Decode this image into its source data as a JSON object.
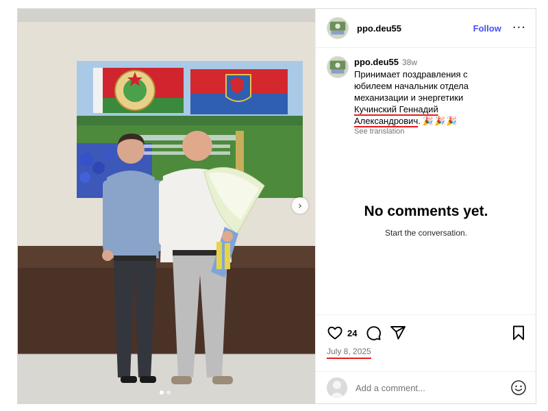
{
  "header": {
    "username": "ppo.deu55",
    "follow_label": "Follow",
    "more_label": "···"
  },
  "caption": {
    "username": "ppo.deu55",
    "time": "38w",
    "text_plain": "Принимает поздравления с юбилеем начальник отдела механизации и энергетики ",
    "text_name": "Кучинский Геннадий Александрович",
    "text_end": ".",
    "emoji": "🎉🎉🎉",
    "see_translation": "See translation"
  },
  "comments": {
    "empty_title": "No comments yet.",
    "empty_subtitle": "Start the conversation."
  },
  "actions": {
    "like_count": "24",
    "date": "July 8, 2025"
  },
  "add_comment": {
    "placeholder": "Add a comment..."
  },
  "carousel": {
    "slide_count": 2,
    "active_slide": 1
  },
  "icons": {
    "like": "heart-icon",
    "comment": "comment-icon",
    "share": "share-icon",
    "save": "bookmark-icon",
    "next": "chevron-right-icon",
    "emoji": "smiley-icon"
  },
  "colors": {
    "accent": "#4150f7",
    "underline": "#e41a1a",
    "muted": "#737373"
  }
}
